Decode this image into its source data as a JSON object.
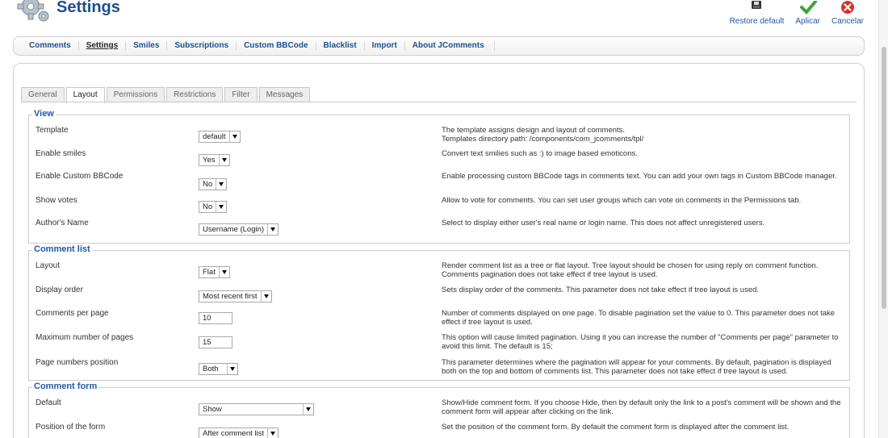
{
  "header": {
    "title": "Settings",
    "toolbar": [
      {
        "label": "Restore default",
        "icon": "floppy-disk-icon"
      },
      {
        "label": "Aplicar",
        "icon": "checkmark-icon"
      },
      {
        "label": "Cancelar",
        "icon": "cancel-icon"
      }
    ]
  },
  "submenu": [
    {
      "label": "Comments",
      "active": false
    },
    {
      "label": "Settings",
      "active": true
    },
    {
      "label": "Smiles",
      "active": false
    },
    {
      "label": "Subscriptions",
      "active": false
    },
    {
      "label": "Custom BBCode",
      "active": false
    },
    {
      "label": "Blacklist",
      "active": false
    },
    {
      "label": "Import",
      "active": false
    },
    {
      "label": "About JComments",
      "active": false
    }
  ],
  "tabs": [
    {
      "label": "General",
      "active": false
    },
    {
      "label": "Layout",
      "active": true
    },
    {
      "label": "Permissions",
      "active": false
    },
    {
      "label": "Restrictions",
      "active": false
    },
    {
      "label": "Filter",
      "active": false
    },
    {
      "label": "Messages",
      "active": false
    }
  ],
  "view": {
    "legend": "View",
    "rows": [
      {
        "label": "Template",
        "value": "default",
        "desc": "The template assigns design and layout of comments.\nTemplates directory path: /components/com_jcomments/tpl/"
      },
      {
        "label": "Enable smiles",
        "value": "Yes",
        "desc": "Convert text smilies such as :) to image based emoticons."
      },
      {
        "label": "Enable Custom BBCode",
        "value": "No",
        "desc": "Enable processing custom BBCode tags in comments text. You can add your own tags in Custom BBCode manager."
      },
      {
        "label": "Show votes",
        "value": "No",
        "desc": "Allow to vote for comments. You can set user groups which can vote on comments in the Permissions tab."
      },
      {
        "label": "Author's Name",
        "value": "Username (Login)",
        "desc": "Select to display either user's real name or login name. This does not affect unregistered users."
      }
    ]
  },
  "comment_list": {
    "legend": "Comment list",
    "rows": [
      {
        "label": "Layout",
        "value": "Flat",
        "desc": "Render comment list as a tree or flat layout. Tree layout should be chosen for using reply on comment function.\nComments pagination does not take effect if tree layout is used."
      },
      {
        "label": "Display order",
        "value": "Most recent first",
        "desc": "Sets display order of the comments. This parameter does not take effect if tree layout is used."
      },
      {
        "label": "Comments per page",
        "value": "10",
        "desc": "Number of comments displayed on one page. To disable pagination set the value to 0. This parameter does not take effect if tree layout is used."
      },
      {
        "label": "Maximum number of pages",
        "value": "15",
        "desc": "This option will cause limited pagination. Using it you can increase the number of \"Comments per page\" parameter to avoid this limit. The default is 15;"
      },
      {
        "label": "Page numbers position",
        "value": "Both",
        "desc": "This parameter determines where the pagination will appear for your comments. By default, pagination is displayed both on the top and bottom of comments list. This parameter does not take effect if tree layout is used."
      }
    ]
  },
  "comment_form": {
    "legend": "Comment form",
    "rows": [
      {
        "label": "Default",
        "value": "Show",
        "desc": "Show/Hide comment form. If you choose Hide, then by default only the link to a post's comment will be shown and the comment form will appear after clicking on the link."
      },
      {
        "label": "Position of the form",
        "value": "After comment list",
        "desc": "Set the position of the comment form. By default the comment form is displayed after the comment list."
      }
    ]
  }
}
